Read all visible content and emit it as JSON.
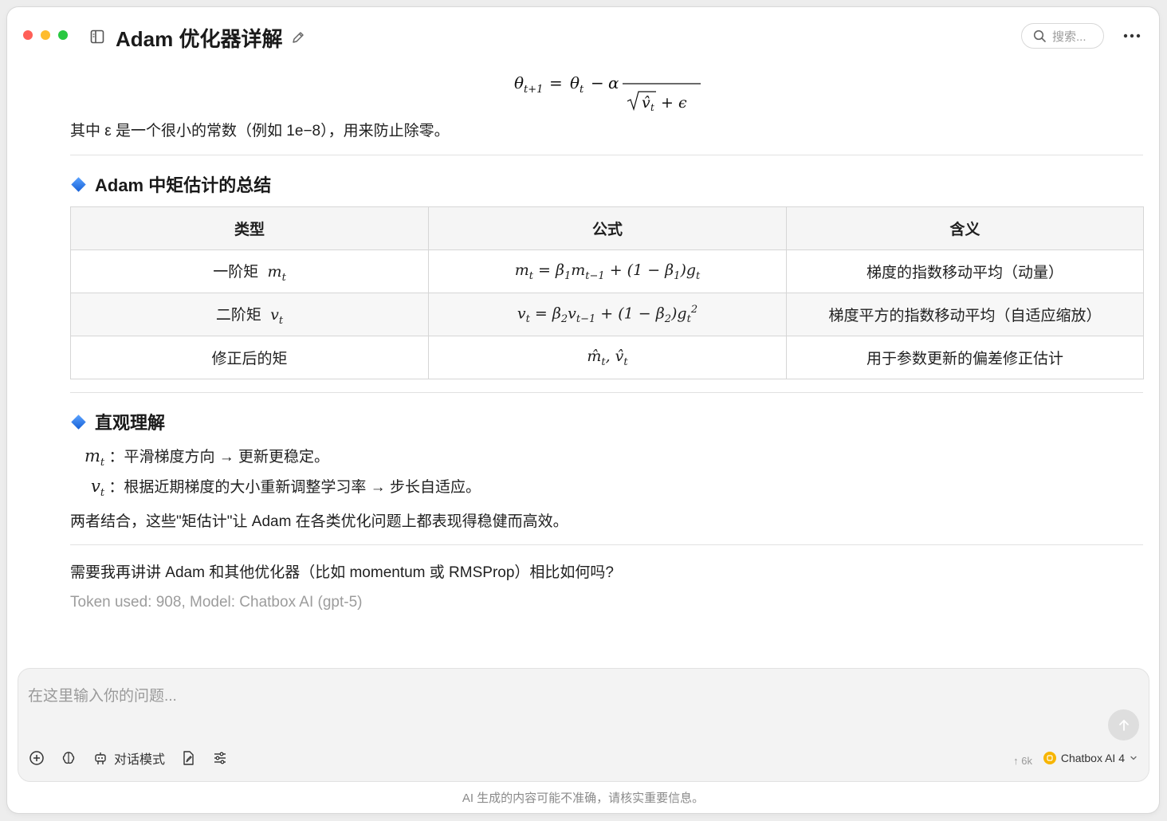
{
  "window": {
    "title": "Adam 优化器详解",
    "traffic_colors": [
      "#ff5f57",
      "#febc2e",
      "#28c840"
    ]
  },
  "search": {
    "placeholder": "搜索..."
  },
  "content": {
    "epsilon_note": "其中 ε 是一个很小的常数（例如 1e−8），用来防止除零。",
    "section_summary_title": "Adam 中矩估计的总结",
    "table": {
      "headers": [
        "类型",
        "公式",
        "含义"
      ],
      "rows": [
        {
          "type": "一阶矩",
          "meaning": "梯度的指数移动平均（动量）"
        },
        {
          "type": "二阶矩",
          "meaning": "梯度平方的指数移动平均（自适应缩放）"
        },
        {
          "type": "修正后的矩",
          "meaning": "用于参数更新的偏差修正估计"
        }
      ]
    },
    "section_intuition_title": "直观理解",
    "bullet_m": "：平滑梯度方向 → 更新更稳定。",
    "bullet_v": "：根据近期梯度的大小重新调整学习率 → 步长自适应。",
    "conclusion": "两者结合，这些\"矩估计\"让 Adam 在各类优化问题上都表现得稳健而高效。",
    "question": "需要我再讲讲 Adam 和其他优化器（比如 momentum 或 RMSProp）相比如何吗?",
    "token_info": "Token used: 908, Model: Chatbox AI (gpt-5)"
  },
  "input": {
    "placeholder": "在这里输入你的问题...",
    "mode_label": "对话模式",
    "token_indicator": "↑ 6k",
    "model_name": "Chatbox AI 4"
  },
  "footer": {
    "disclaimer": "AI 生成的内容可能不准确，请核实重要信息。"
  },
  "colors": {
    "accent_diamond": "#2f7bef",
    "model_badge": "#f7b500"
  }
}
